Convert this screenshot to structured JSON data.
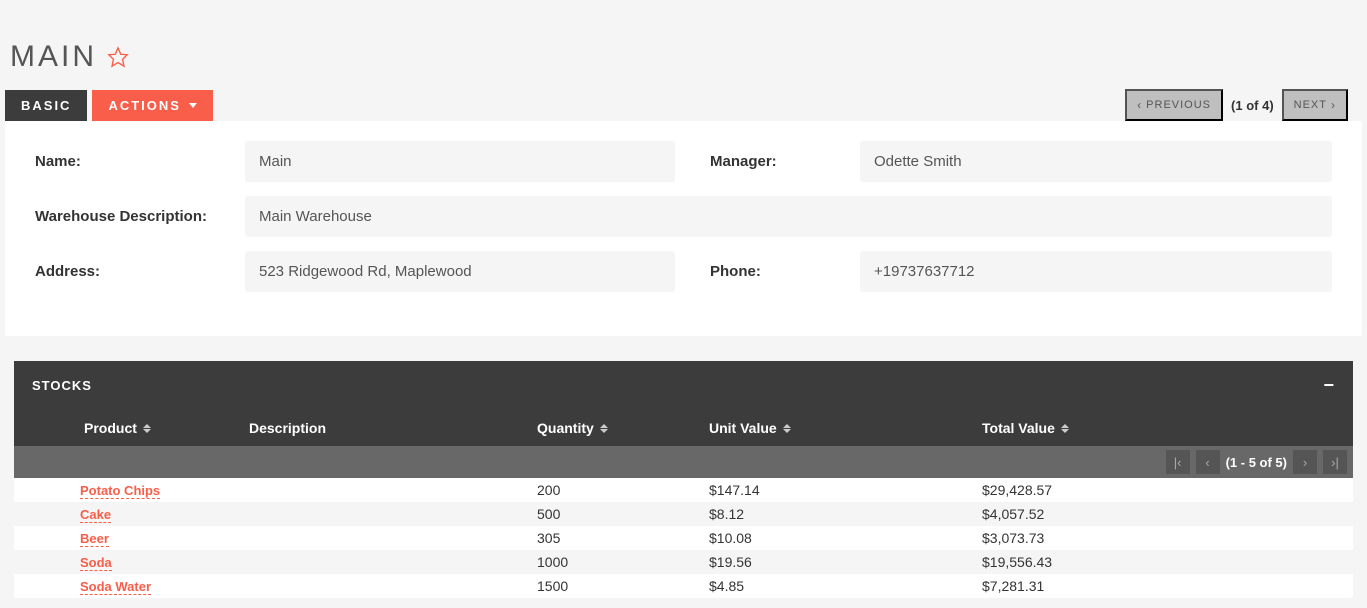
{
  "header": {
    "title": "MAIN"
  },
  "toolbar": {
    "basic_label": "BASIC",
    "actions_label": "ACTIONS",
    "previous_label": "PREVIOUS",
    "next_label": "NEXT",
    "pager_text": "(1 of 4)"
  },
  "form": {
    "name_label": "Name:",
    "name_value": "Main",
    "manager_label": "Manager:",
    "manager_value": "Odette Smith",
    "desc_label": "Warehouse Description:",
    "desc_value": "Main Warehouse",
    "address_label": "Address:",
    "address_value": "523 Ridgewood Rd, Maplewood",
    "phone_label": "Phone:",
    "phone_value": "+19737637712"
  },
  "stocks": {
    "title": "STOCKS",
    "columns": {
      "product": "Product",
      "description": "Description",
      "quantity": "Quantity",
      "unit_value": "Unit Value",
      "total_value": "Total Value"
    },
    "pager_text": "(1 - 5 of 5)",
    "rows": [
      {
        "product": "Potato Chips",
        "description": "",
        "quantity": "200",
        "unit_value": "$147.14",
        "total_value": "$29,428.57"
      },
      {
        "product": "Cake",
        "description": "",
        "quantity": "500",
        "unit_value": "$8.12",
        "total_value": "$4,057.52"
      },
      {
        "product": "Beer",
        "description": "",
        "quantity": "305",
        "unit_value": "$10.08",
        "total_value": "$3,073.73"
      },
      {
        "product": "Soda",
        "description": "",
        "quantity": "1000",
        "unit_value": "$19.56",
        "total_value": "$19,556.43"
      },
      {
        "product": "Soda Water",
        "description": "",
        "quantity": "1500",
        "unit_value": "$4.85",
        "total_value": "$7,281.31"
      }
    ]
  }
}
